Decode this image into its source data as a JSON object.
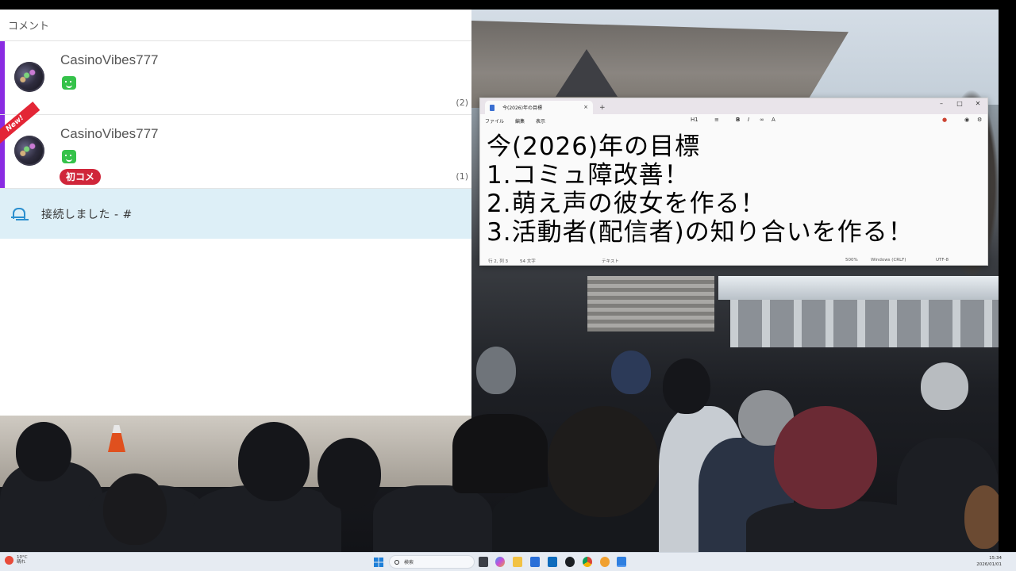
{
  "comment_panel": {
    "header": "コメント",
    "comments": [
      {
        "username": "CasinoVibes777",
        "count": "(2)",
        "new": false,
        "badge": ""
      },
      {
        "username": "CasinoVibes777",
        "count": "(1)",
        "new": true,
        "new_label": "New!",
        "badge": "初コメ"
      }
    ],
    "status": "接続しました - #"
  },
  "notepad": {
    "tab_title": "今(2026)年の目標",
    "tab_close": "×",
    "new_tab": "+",
    "window_controls": {
      "minimize": "–",
      "maximize": "□",
      "close": "✕"
    },
    "menu": [
      "ファイル",
      "編集",
      "表示"
    ],
    "format": {
      "heading": "H1",
      "bold": "B",
      "italic": "I"
    },
    "lines": [
      "今(2026)年の目標",
      "1.コミュ障改善！",
      "2.萌え声の彼女を作る！",
      "3.活動者(配信者)の知り合いを作る！"
    ],
    "status": {
      "position": "行 2, 列 3",
      "chars": "54 文字",
      "mode": "テキスト",
      "zoom": "500%",
      "line_ending": "Windows (CRLF)",
      "encoding": "UTF-8"
    }
  },
  "taskbar": {
    "weather_temp": "10°C",
    "weather_text": "晴れ",
    "search_placeholder": "検索",
    "time": "15:34",
    "date": "2026/01/01",
    "apps": [
      "task-view",
      "copilot",
      "file-explorer",
      "calendar",
      "outlook",
      "github",
      "chrome",
      "outlook-blue",
      "notepad"
    ]
  },
  "colors": {
    "accent_purple": "#8a2be2",
    "first_comment_red": "#d0263a",
    "status_bg": "#ddeff7",
    "stamp_green": "#35c24a"
  }
}
